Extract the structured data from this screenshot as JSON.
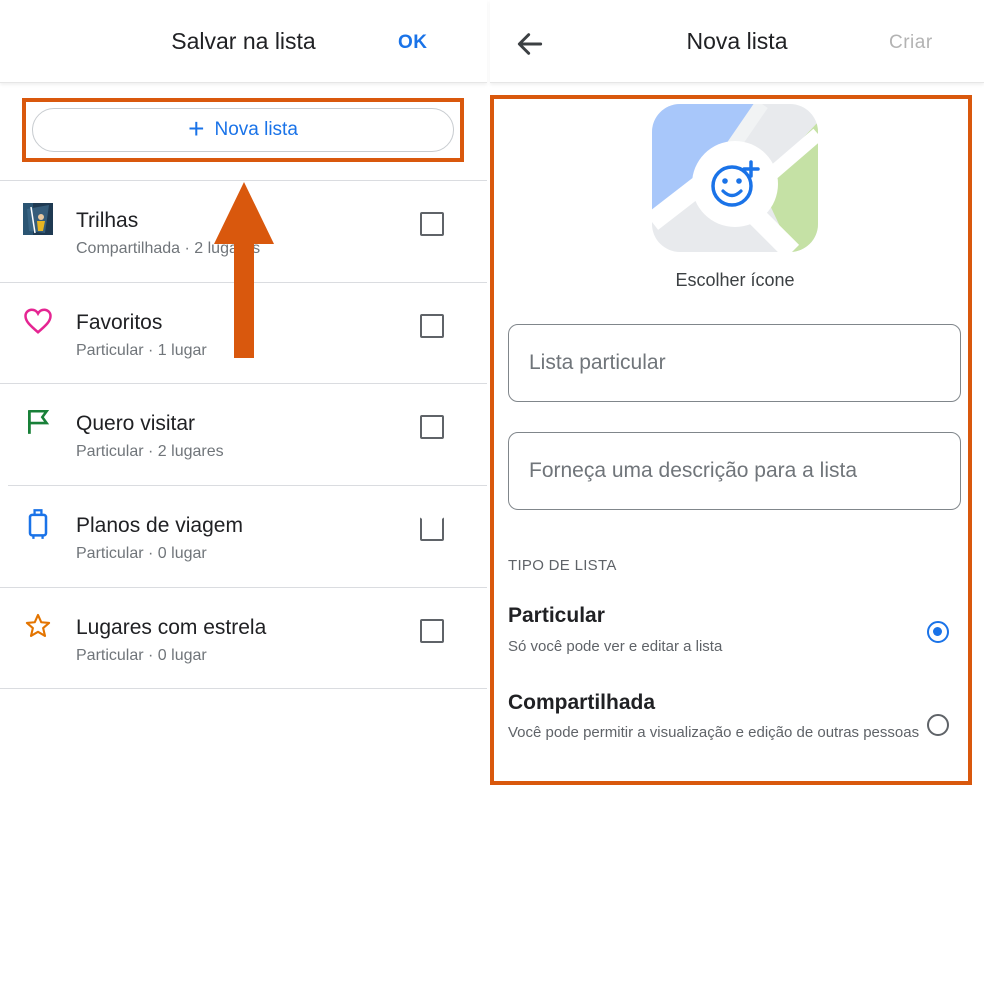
{
  "left": {
    "title": "Salvar na lista",
    "ok_label": "OK",
    "new_list_label": "Nova lista",
    "lists": [
      {
        "title": "Trilhas",
        "subtitle": "Compartilhada · 2 lugares",
        "icon": "trail-image-icon"
      },
      {
        "title": "Favoritos",
        "subtitle": "Particular · 1 lugar",
        "icon": "heart-icon",
        "color": "#e52592"
      },
      {
        "title": "Quero visitar",
        "subtitle": "Particular · 2 lugares",
        "icon": "flag-icon",
        "color": "#188038"
      },
      {
        "title": "Planos de viagem",
        "subtitle": "Particular · 0 lugar",
        "icon": "suitcase-icon",
        "color": "#1a73e8"
      },
      {
        "title": "Lugares com estrela",
        "subtitle": "Particular · 0 lugar",
        "icon": "star-icon",
        "color": "#e37400"
      }
    ]
  },
  "right": {
    "title": "Nova lista",
    "create_label": "Criar",
    "choose_icon_label": "Escolher ícone",
    "name_placeholder": "Lista particular",
    "description_placeholder": "Forneça uma descrição para a lista",
    "list_type_header": "TIPO DE LISTA",
    "options": [
      {
        "title": "Particular",
        "subtitle": "Só você pode ver e editar a lista",
        "selected": true
      },
      {
        "title": "Compartilhada",
        "subtitle": "Você pode permitir a visualização e edição de outras pessoas",
        "selected": false
      }
    ]
  },
  "colors": {
    "accent": "#1a73e8",
    "highlight": "#d9580d",
    "disabled": "#b3b3b3"
  }
}
